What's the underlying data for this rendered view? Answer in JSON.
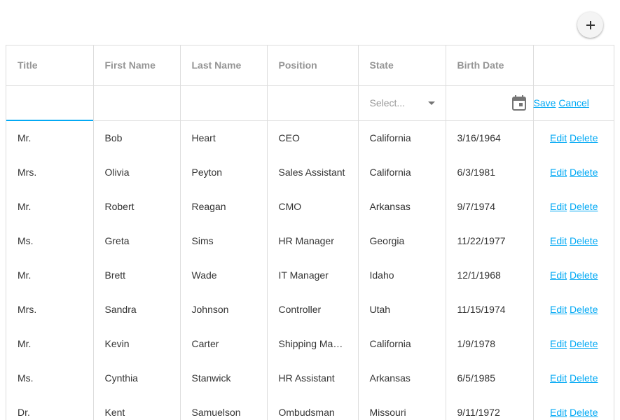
{
  "toolbar": {
    "add_icon": "plus-icon"
  },
  "columns": [
    "Title",
    "First Name",
    "Last Name",
    "Position",
    "State",
    "Birth Date",
    ""
  ],
  "edit_row": {
    "state_placeholder": "Select...",
    "date_icon": "calendar-icon",
    "save_label": "Save",
    "cancel_label": "Cancel"
  },
  "rows": [
    {
      "title": "Mr.",
      "first": "Bob",
      "last": "Heart",
      "position": "CEO",
      "state": "California",
      "birth": "3/16/1964"
    },
    {
      "title": "Mrs.",
      "first": "Olivia",
      "last": "Peyton",
      "position": "Sales Assistant",
      "state": "California",
      "birth": "6/3/1981"
    },
    {
      "title": "Mr.",
      "first": "Robert",
      "last": "Reagan",
      "position": "CMO",
      "state": "Arkansas",
      "birth": "9/7/1974"
    },
    {
      "title": "Ms.",
      "first": "Greta",
      "last": "Sims",
      "position": "HR Manager",
      "state": "Georgia",
      "birth": "11/22/1977"
    },
    {
      "title": "Mr.",
      "first": "Brett",
      "last": "Wade",
      "position": "IT Manager",
      "state": "Idaho",
      "birth": "12/1/1968"
    },
    {
      "title": "Mrs.",
      "first": "Sandra",
      "last": "Johnson",
      "position": "Controller",
      "state": "Utah",
      "birth": "11/15/1974"
    },
    {
      "title": "Mr.",
      "first": "Kevin",
      "last": "Carter",
      "position": "Shipping Manager",
      "state": "California",
      "birth": "1/9/1978"
    },
    {
      "title": "Ms.",
      "first": "Cynthia",
      "last": "Stanwick",
      "position": "HR Assistant",
      "state": "Arkansas",
      "birth": "6/5/1985"
    },
    {
      "title": "Dr.",
      "first": "Kent",
      "last": "Samuelson",
      "position": "Ombudsman",
      "state": "Missouri",
      "birth": "9/11/1972"
    }
  ],
  "row_actions": {
    "edit_label": "Edit",
    "delete_label": "Delete"
  },
  "colors": {
    "accent": "#03a9f4",
    "border": "#dddddd",
    "header_text": "#959595"
  }
}
